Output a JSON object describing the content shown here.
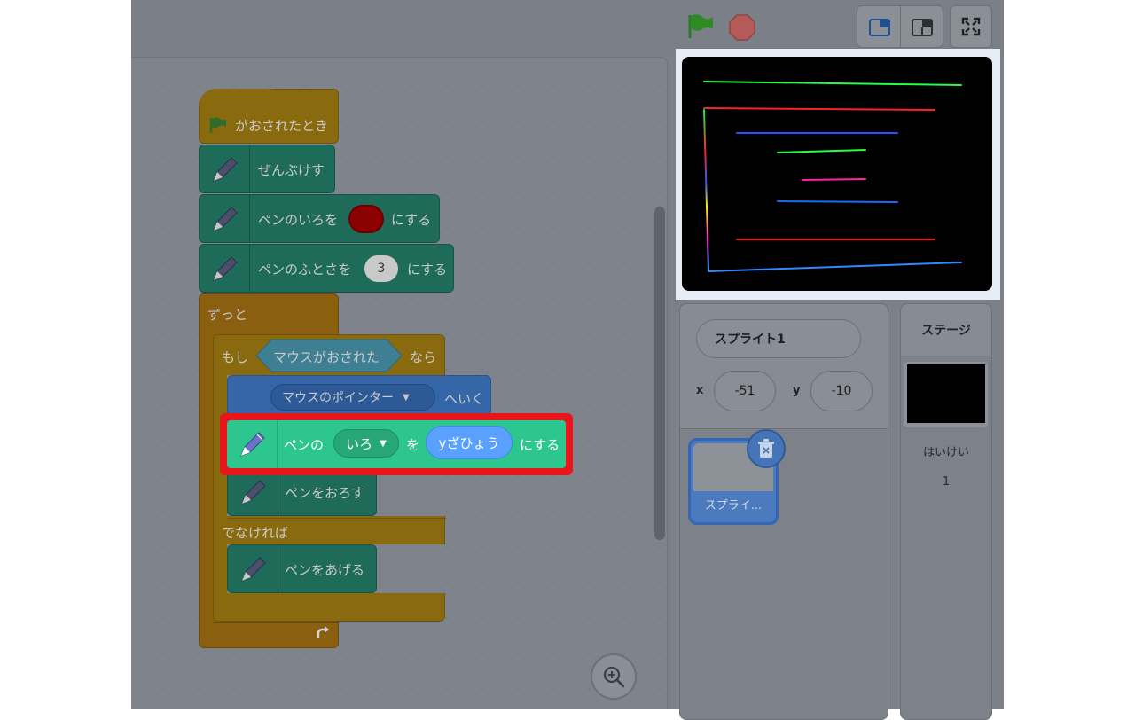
{
  "blocks": {
    "when_flag": "がおされたとき",
    "clear": "ぜんぶけす",
    "set_color_prefix": "ペンのいろを",
    "set_color_suffix": "にする",
    "set_size_prefix": "ペンのふとさを",
    "set_size_value": "3",
    "set_size_suffix": "にする",
    "forever": "ずっと",
    "if_label": "もし",
    "if_condition": "マウスがおされた",
    "if_then": "なら",
    "goto_target": "マウスのポインター",
    "goto_suffix": "へいく",
    "pen_down": "ペンをおろす",
    "else_label": "でなければ",
    "pen_up": "ペンをあげる"
  },
  "highlighted_block": {
    "prefix": "ペンの",
    "param": "いろ",
    "middle": "を",
    "reporter": "yざひょう",
    "suffix": "にする"
  },
  "sprite_info": {
    "name": "スプライト1",
    "x_label": "x",
    "x_value": "-51",
    "y_label": "y",
    "y_value": "-10"
  },
  "sprite_list": [
    {
      "label": "スプライ..."
    }
  ],
  "stage_pane": {
    "title": "ステージ",
    "backdrops_label": "はいけい",
    "backdrops_count": "1"
  },
  "colors": {
    "highlight_border": "#e8161a",
    "highlight_block": "#2ec68f",
    "stage_background": "#000000"
  },
  "icons": [
    "green-flag-icon",
    "stop-icon",
    "small-stage-icon",
    "large-stage-icon",
    "fullscreen-icon",
    "zoom-in-icon",
    "pen-icon",
    "trash-icon",
    "loop-arrow-icon"
  ]
}
